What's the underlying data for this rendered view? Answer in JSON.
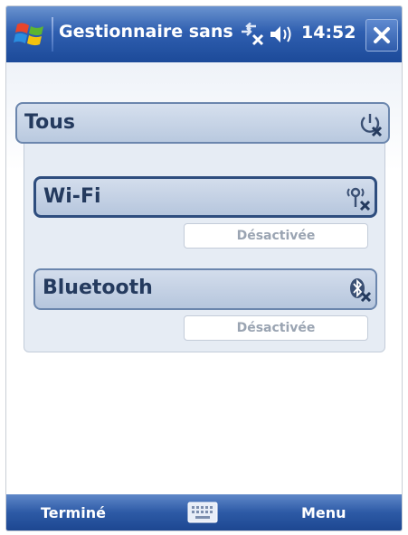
{
  "window": {
    "title": "Gestionnaire sans",
    "clock": "14:52",
    "icons": [
      "windows-start-icon",
      "connectivity-icon",
      "volume-icon",
      "close-icon"
    ]
  },
  "group": {
    "label": "Tous",
    "icon": "power-off-icon"
  },
  "radios": [
    {
      "label": "Wi-Fi",
      "status": "Désactivée",
      "icon": "wifi-off-icon"
    },
    {
      "label": "Bluetooth",
      "status": "Désactivée",
      "icon": "bluetooth-off-icon"
    }
  ],
  "softkeys": {
    "left": "Terminé",
    "right": "Menu",
    "center_icon": "keyboard-icon"
  },
  "colors": {
    "titlebar": "#2f5fb0",
    "header_fill": "#c6d3e6",
    "header_text": "#243a5e",
    "status_text": "#9aa4b2"
  }
}
